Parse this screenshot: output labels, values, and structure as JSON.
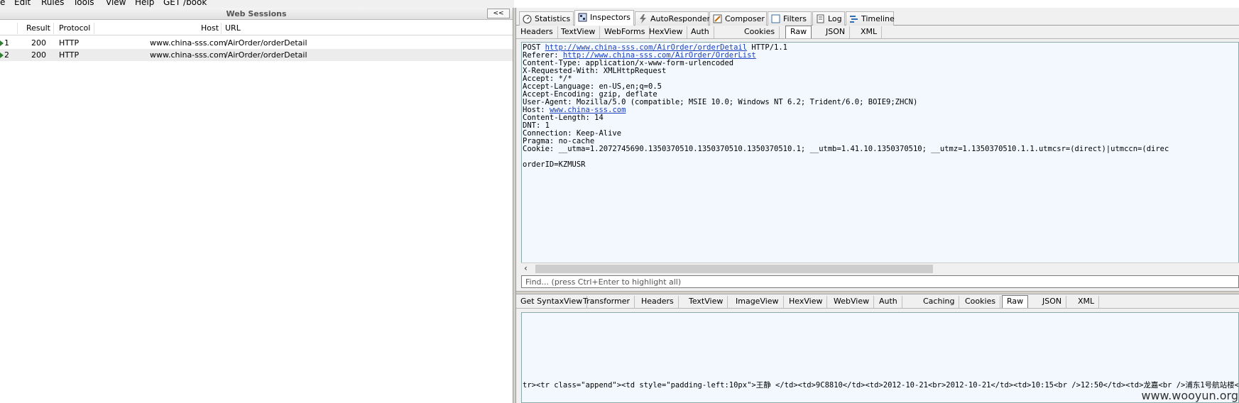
{
  "menu": [
    "e",
    "Edit",
    "Rules",
    "Tools",
    "View",
    "Help",
    "GET /book"
  ],
  "sessions": {
    "title": "Web Sessions",
    "collapse": "<<",
    "columns": [
      "Result",
      "Protocol",
      "Host",
      "URL"
    ],
    "rows": [
      {
        "num": "1",
        "result": "200",
        "protocol": "HTTP",
        "host": "www.china-sss.com",
        "url": "/AirOrder/orderDetail"
      },
      {
        "num": "2",
        "result": "200",
        "protocol": "HTTP",
        "host": "www.china-sss.com",
        "url": "/AirOrder/orderDetail"
      }
    ]
  },
  "main_tabs": [
    "Statistics",
    "Inspectors",
    "AutoResponder",
    "Composer",
    "Filters",
    "Log",
    "Timeline"
  ],
  "request_tabs": [
    "Headers",
    "TextView",
    "WebForms",
    "HexView",
    "Auth",
    "Cookies",
    "Raw",
    "JSON",
    "XML"
  ],
  "request": {
    "l1_pre": "POST ",
    "l1_link": "http://www.china-sss.com/AirOrder/orderDetail",
    "l1_post": " HTTP/1.1",
    "l2_pre": "Referer: ",
    "l2_link": "http://www.china-sss.com/AirOrder/OrderList",
    "l3": "Content-Type: application/x-www-form-urlencoded",
    "l4": "X-Requested-With: XMLHttpRequest",
    "l5": "Accept: */*",
    "l6": "Accept-Language: en-US,en;q=0.5",
    "l7": "Accept-Encoding: gzip, deflate",
    "l8": "User-Agent: Mozilla/5.0 (compatible; MSIE 10.0; Windows NT 6.2; Trident/6.0; BOIE9;ZHCN)",
    "l9_pre": "Host: ",
    "l9_link": "www.china-sss.com",
    "l10": "Content-Length: 14",
    "l11": "DNT: 1",
    "l12": "Connection: Keep-Alive",
    "l13": "Pragma: no-cache",
    "l14": "Cookie: __utma=1.2072745690.1350370510.1350370510.1350370510.1; __utmb=1.41.10.1350370510; __utmz=1.1350370510.1.1.utmcsr=(direct)|utmccn=(direc",
    "l15": "",
    "l16": "orderID=KZMUSR"
  },
  "find_placeholder": "Find... (press Ctrl+Enter to highlight all)",
  "response_tabs": [
    "Get SyntaxView",
    "Transformer",
    "Headers",
    "TextView",
    "ImageView",
    "HexView",
    "WebView",
    "Auth",
    "Caching",
    "Cookies",
    "Raw",
    "JSON",
    "XML"
  ],
  "response_line": "tr><tr class=\"append\"><td style=\"padding-left:10px\">王静 </td><td>9C8810</td><td>2012-10-21<br>2012-10-21</td><td>10:15<br />12:50</td><td>龙嘉<br />浦东1号航站楼</td><td",
  "watermark": "www.wooyun.org"
}
